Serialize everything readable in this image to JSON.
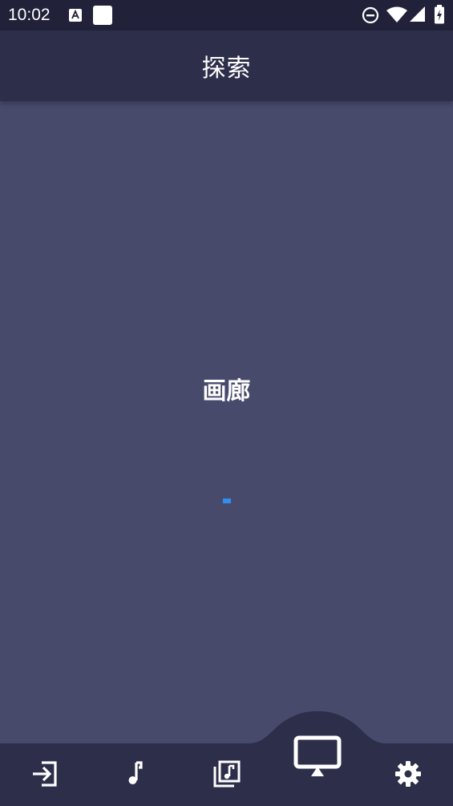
{
  "status_bar": {
    "time": "10:02",
    "left_icons": [
      "accessibility-font-icon",
      "white-square-icon"
    ],
    "right_icons": [
      "dnd-icon",
      "wifi-icon",
      "cellular-icon",
      "battery-charging-icon"
    ]
  },
  "app_bar": {
    "title": "探索"
  },
  "content": {
    "title": "画廊",
    "loading_indicator": "progress-indicator"
  },
  "bottom_nav": {
    "items": [
      {
        "icon": "login-icon",
        "active": false
      },
      {
        "icon": "music-note-icon",
        "active": false
      },
      {
        "icon": "music-library-icon",
        "active": false
      },
      {
        "icon": "desktop-monitor-icon",
        "active": true
      },
      {
        "icon": "gear-icon",
        "active": false
      }
    ]
  },
  "colors": {
    "background": "#484a6c",
    "app_bar": "#2d2e4a",
    "status_bar": "#21223a",
    "bottom_nav": "#2d2e4a",
    "accent": "#2f8ff0",
    "icon": "#ffffff"
  }
}
